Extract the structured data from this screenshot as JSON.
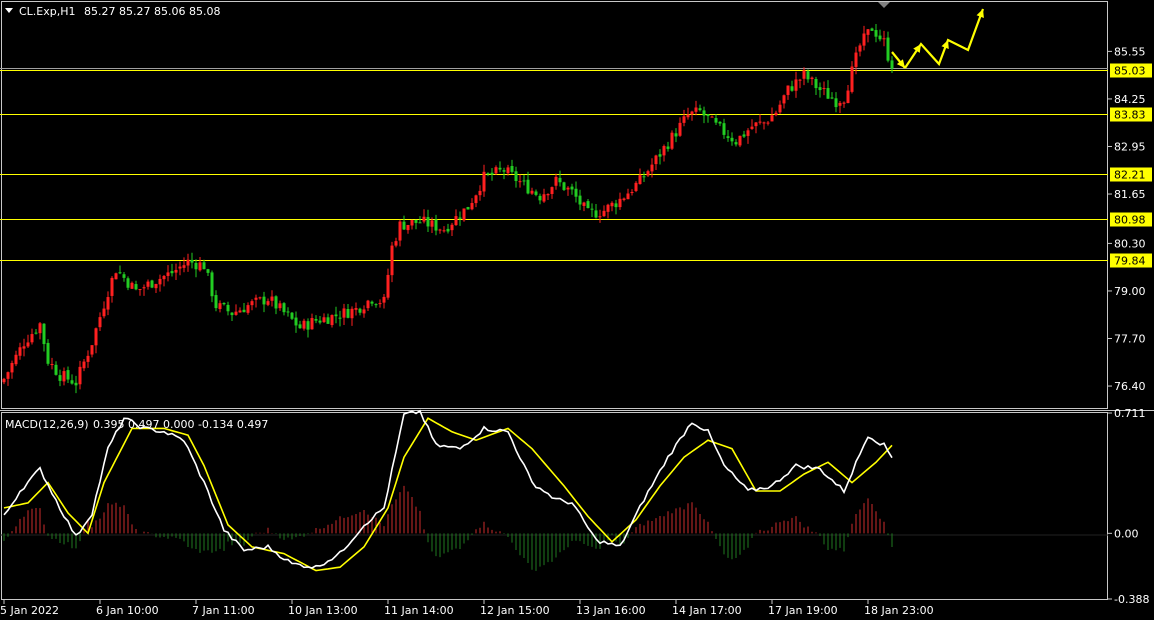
{
  "header": {
    "symbol": "CL.Exp,H1",
    "ohlc": "85.27 85.27 85.06 85.08",
    "indicator": "MACD(12,26,9)",
    "indicator_values": "0.395 0.497 0.000 -0.134 0.497"
  },
  "colors": {
    "background": "#000000",
    "bull": "#ff2020",
    "bear": "#22cc22",
    "level": "#ffff00",
    "macd_line": "#ffffff",
    "signal_line": "#ffff00",
    "hist_pos": "#cc2b2b",
    "hist_neg": "#1f7a1f",
    "arrow": "#ffff00"
  },
  "chart_data": [
    {
      "type": "candlestick",
      "name": "price",
      "ylim": [
        75.8,
        86.9
      ],
      "y_ticks": [
        "85.55",
        "84.25",
        "82.95",
        "81.65",
        "80.30",
        "79.00",
        "77.70",
        "76.40"
      ],
      "y_tick_values": [
        85.55,
        84.25,
        82.95,
        81.65,
        80.3,
        79.0,
        77.7,
        76.4
      ],
      "levels": [
        {
          "label": "85.03",
          "value": 85.03
        },
        {
          "label": "83.83",
          "value": 83.83
        },
        {
          "label": "82.21",
          "value": 82.21
        },
        {
          "label": "80.98",
          "value": 80.98
        },
        {
          "label": "79.84",
          "value": 79.84
        }
      ],
      "x_labels": [
        "5 Jan 2022",
        "6 Jan 10:00",
        "7 Jan 11:00",
        "10 Jan 13:00",
        "11 Jan 14:00",
        "12 Jan 15:00",
        "13 Jan 16:00",
        "14 Jan 17:00",
        "17 Jan 19:00",
        "18 Jan 23:00"
      ],
      "x_label_bars": [
        0,
        24,
        48,
        72,
        96,
        120,
        144,
        168,
        192,
        216
      ],
      "close_path": [
        [
          0,
          76.6
        ],
        [
          5,
          77.6
        ],
        [
          9,
          78.1
        ],
        [
          11,
          77.1
        ],
        [
          14,
          76.7
        ],
        [
          18,
          76.5
        ],
        [
          22,
          77.6
        ],
        [
          26,
          79.0
        ],
        [
          28,
          79.6
        ],
        [
          33,
          79.0
        ],
        [
          38,
          79.3
        ],
        [
          42,
          79.5
        ],
        [
          46,
          79.8
        ],
        [
          50,
          79.7
        ],
        [
          53,
          78.6
        ],
        [
          57,
          78.4
        ],
        [
          61,
          78.6
        ],
        [
          66,
          78.8
        ],
        [
          70,
          78.4
        ],
        [
          74,
          78.0
        ],
        [
          78,
          78.2
        ],
        [
          82,
          78.3
        ],
        [
          88,
          78.5
        ],
        [
          92,
          78.8
        ],
        [
          95,
          78.7
        ],
        [
          97,
          80.2
        ],
        [
          99,
          80.8
        ],
        [
          104,
          80.9
        ],
        [
          110,
          80.7
        ],
        [
          116,
          81.3
        ],
        [
          120,
          82.1
        ],
        [
          125,
          82.3
        ],
        [
          130,
          81.9
        ],
        [
          134,
          81.6
        ],
        [
          138,
          82.0
        ],
        [
          142,
          81.7
        ],
        [
          146,
          81.1
        ],
        [
          150,
          81.2
        ],
        [
          154,
          81.5
        ],
        [
          159,
          82.0
        ],
        [
          163,
          82.6
        ],
        [
          167,
          83.2
        ],
        [
          171,
          83.8
        ],
        [
          174,
          83.9
        ],
        [
          178,
          83.5
        ],
        [
          183,
          83.1
        ],
        [
          187,
          83.5
        ],
        [
          190,
          83.6
        ],
        [
          193,
          83.9
        ],
        [
          196,
          84.5
        ],
        [
          200,
          84.9
        ],
        [
          204,
          84.5
        ],
        [
          208,
          84.2
        ],
        [
          210,
          84.3
        ],
        [
          212,
          85.0
        ],
        [
          214,
          85.7
        ],
        [
          217,
          86.2
        ],
        [
          220,
          85.8
        ],
        [
          222,
          85.08
        ]
      ]
    },
    {
      "type": "macd",
      "name": "MACD(12,26,9)",
      "ylim": [
        -0.388,
        0.711
      ],
      "y_ticks": [
        "0.711",
        "0.00",
        "-0.388"
      ],
      "y_tick_values": [
        0.711,
        0.0,
        -0.388
      ],
      "main_path": [
        [
          0,
          0.1
        ],
        [
          4,
          0.25
        ],
        [
          9,
          0.38
        ],
        [
          14,
          0.15
        ],
        [
          18,
          -0.02
        ],
        [
          22,
          0.12
        ],
        [
          26,
          0.5
        ],
        [
          30,
          0.68
        ],
        [
          35,
          0.62
        ],
        [
          40,
          0.6
        ],
        [
          45,
          0.55
        ],
        [
          50,
          0.3
        ],
        [
          55,
          0.02
        ],
        [
          60,
          -0.1
        ],
        [
          66,
          -0.08
        ],
        [
          72,
          -0.18
        ],
        [
          78,
          -0.2
        ],
        [
          84,
          -0.12
        ],
        [
          90,
          0.05
        ],
        [
          95,
          0.15
        ],
        [
          100,
          0.7
        ],
        [
          104,
          0.72
        ],
        [
          108,
          0.52
        ],
        [
          114,
          0.5
        ],
        [
          120,
          0.62
        ],
        [
          126,
          0.6
        ],
        [
          132,
          0.3
        ],
        [
          138,
          0.2
        ],
        [
          142,
          0.18
        ],
        [
          148,
          -0.04
        ],
        [
          154,
          -0.08
        ],
        [
          160,
          0.2
        ],
        [
          166,
          0.45
        ],
        [
          172,
          0.66
        ],
        [
          176,
          0.6
        ],
        [
          180,
          0.4
        ],
        [
          186,
          0.25
        ],
        [
          192,
          0.28
        ],
        [
          198,
          0.4
        ],
        [
          204,
          0.38
        ],
        [
          210,
          0.25
        ],
        [
          216,
          0.58
        ],
        [
          220,
          0.52
        ],
        [
          222,
          0.45
        ]
      ],
      "signal_path": [
        [
          0,
          0.15
        ],
        [
          6,
          0.18
        ],
        [
          11,
          0.3
        ],
        [
          16,
          0.12
        ],
        [
          21,
          0.0
        ],
        [
          25,
          0.3
        ],
        [
          32,
          0.62
        ],
        [
          40,
          0.62
        ],
        [
          46,
          0.58
        ],
        [
          50,
          0.4
        ],
        [
          56,
          0.05
        ],
        [
          62,
          -0.08
        ],
        [
          70,
          -0.12
        ],
        [
          78,
          -0.22
        ],
        [
          84,
          -0.2
        ],
        [
          90,
          -0.08
        ],
        [
          96,
          0.15
        ],
        [
          100,
          0.45
        ],
        [
          106,
          0.68
        ],
        [
          112,
          0.6
        ],
        [
          118,
          0.55
        ],
        [
          126,
          0.62
        ],
        [
          132,
          0.5
        ],
        [
          140,
          0.28
        ],
        [
          146,
          0.1
        ],
        [
          152,
          -0.05
        ],
        [
          158,
          0.08
        ],
        [
          164,
          0.28
        ],
        [
          170,
          0.45
        ],
        [
          176,
          0.55
        ],
        [
          182,
          0.5
        ],
        [
          188,
          0.25
        ],
        [
          194,
          0.25
        ],
        [
          200,
          0.35
        ],
        [
          206,
          0.42
        ],
        [
          212,
          0.3
        ],
        [
          218,
          0.42
        ],
        [
          222,
          0.52
        ]
      ]
    }
  ]
}
